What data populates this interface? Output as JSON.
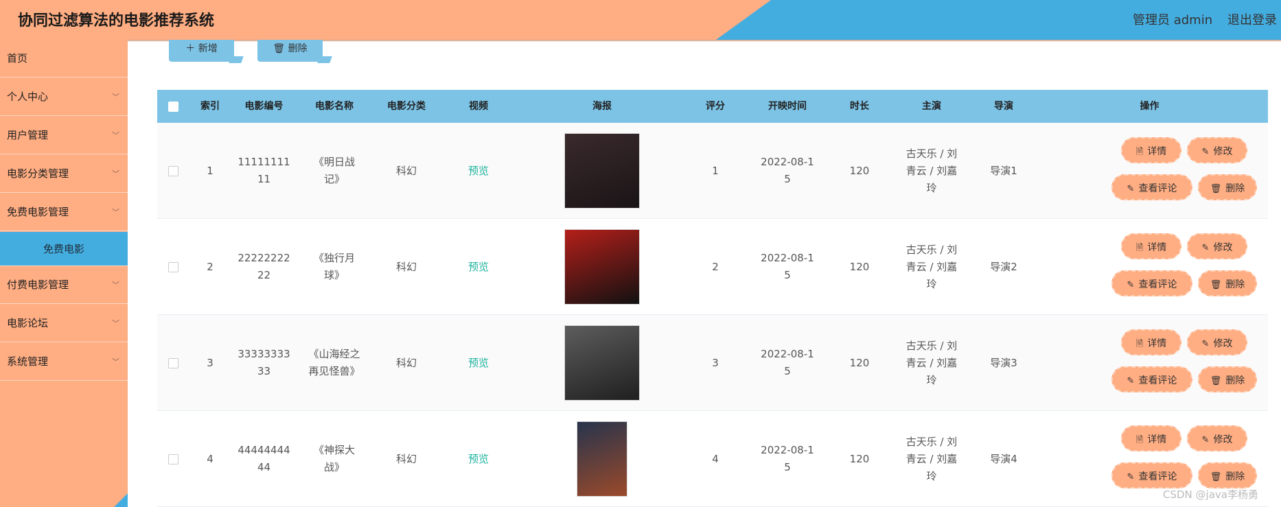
{
  "header": {
    "title": "协同过滤算法的电影推荐系统",
    "user": "管理员 admin",
    "logout": "退出登录"
  },
  "sidebar": {
    "items": [
      {
        "label": "首页",
        "expandable": false
      },
      {
        "label": "个人中心",
        "expandable": true
      },
      {
        "label": "用户管理",
        "expandable": true
      },
      {
        "label": "电影分类管理",
        "expandable": true
      },
      {
        "label": "免费电影管理",
        "expandable": true
      },
      {
        "label": "免费电影",
        "sub": true
      },
      {
        "label": "付费电影管理",
        "expandable": true
      },
      {
        "label": "电影论坛",
        "expandable": true
      },
      {
        "label": "系统管理",
        "expandable": true
      }
    ]
  },
  "toolbar": {
    "add_label": "新增",
    "delete_label": "删除"
  },
  "table": {
    "headers": [
      "索引",
      "电影编号",
      "电影名称",
      "电影分类",
      "视频",
      "海报",
      "评分",
      "开映时间",
      "时长",
      "主演",
      "导演",
      "操作"
    ],
    "preview_label": "预览",
    "actions": {
      "detail": "详情",
      "edit": "修改",
      "comments": "查看评论",
      "delete": "删除"
    },
    "rows": [
      {
        "index": "1",
        "code": "1111111111",
        "name": "《明日战记》",
        "category": "科幻",
        "rating": "1",
        "date": "2022-08-15",
        "duration": "120",
        "cast": "古天乐 / 刘青云 / 刘嘉玲",
        "director": "导演1",
        "poster_colors": [
          "#3a2a2c",
          "#1a1416"
        ]
      },
      {
        "index": "2",
        "code": "2222222222",
        "name": "《独行月球》",
        "category": "科幻",
        "rating": "2",
        "date": "2022-08-15",
        "duration": "120",
        "cast": "古天乐 / 刘青云 / 刘嘉玲",
        "director": "导演2",
        "poster_colors": [
          "#b41f1a",
          "#111111"
        ]
      },
      {
        "index": "3",
        "code": "3333333333",
        "name": "《山海经之再见怪兽》",
        "category": "科幻",
        "rating": "3",
        "date": "2022-08-15",
        "duration": "120",
        "cast": "古天乐 / 刘青云 / 刘嘉玲",
        "director": "导演3",
        "poster_colors": [
          "#5d5d5d",
          "#1f1f1f"
        ]
      },
      {
        "index": "4",
        "code": "4444444444",
        "name": "《神探大战》",
        "category": "科幻",
        "rating": "4",
        "date": "2022-08-15",
        "duration": "120",
        "cast": "古天乐 / 刘青云 / 刘嘉玲",
        "director": "导演4",
        "poster_colors": [
          "#27344d",
          "#9b4a2a"
        ]
      }
    ]
  },
  "watermark": "CSDN @java李杨勇",
  "colors": {
    "accent_orange": "#ffad82",
    "accent_blue": "#44ade0",
    "header_table": "#7cc3e6",
    "preview_green": "#1fb39e"
  }
}
